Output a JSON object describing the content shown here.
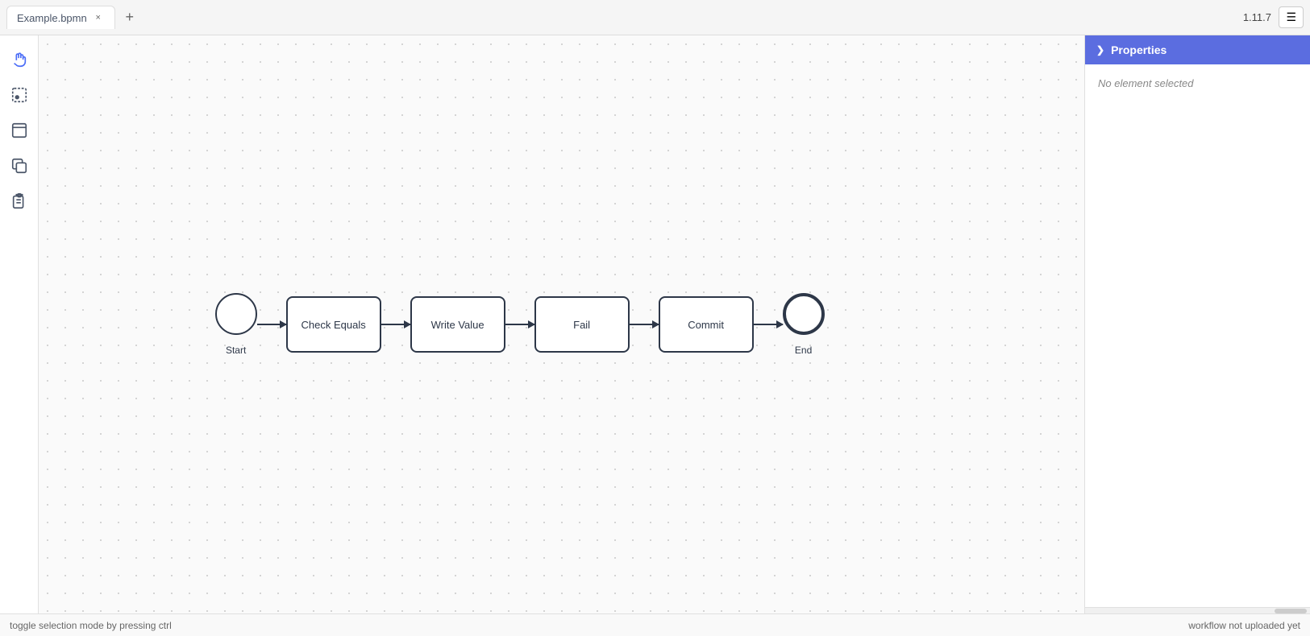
{
  "titlebar": {
    "tab_label": "Example.bpmn",
    "close_label": "×",
    "new_tab_label": "+",
    "version": "1.11.7",
    "menu_icon": "☰"
  },
  "toolbar": {
    "hand_tool_label": "Hand tool",
    "select_tool_label": "Select",
    "frame_tool_label": "Frame",
    "copy_tool_label": "Copy",
    "paste_tool_label": "Paste"
  },
  "diagram": {
    "start_label": "Start",
    "end_label": "End",
    "tasks": [
      {
        "id": "check-equals",
        "label": "Check Equals"
      },
      {
        "id": "write-value",
        "label": "Write Value"
      },
      {
        "id": "fail",
        "label": "Fail"
      },
      {
        "id": "commit",
        "label": "Commit"
      }
    ]
  },
  "properties": {
    "header_label": "Properties",
    "empty_label": "No element selected"
  },
  "statusbar": {
    "left_text": "toggle selection mode by pressing ctrl",
    "right_text": "workflow not uploaded yet"
  }
}
